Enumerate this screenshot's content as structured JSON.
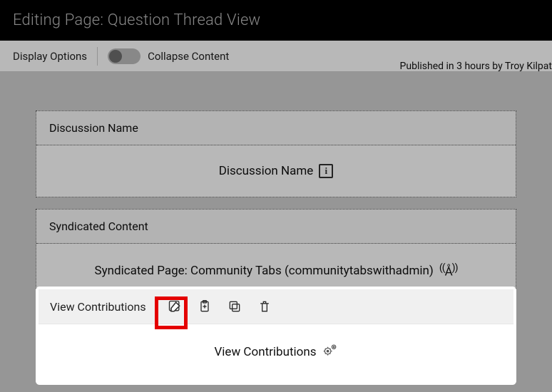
{
  "header": {
    "title": "Editing Page: Question Thread View"
  },
  "options": {
    "display_label": "Display Options",
    "collapse_label": "Collapse Content"
  },
  "publish_line": "Published in 3 hours by Troy Kilpat",
  "blocks": {
    "discussion": {
      "header": "Discussion Name",
      "body_label": "Discussion Name"
    },
    "syndicated": {
      "header": "Syndicated Content",
      "body_label": "Syndicated Page: Community Tabs (communitytabswithadmin)"
    }
  },
  "focus": {
    "title": "View Contributions",
    "body_label": "View Contributions"
  },
  "icons": {
    "info": "i",
    "broadcast": "((Å))"
  }
}
